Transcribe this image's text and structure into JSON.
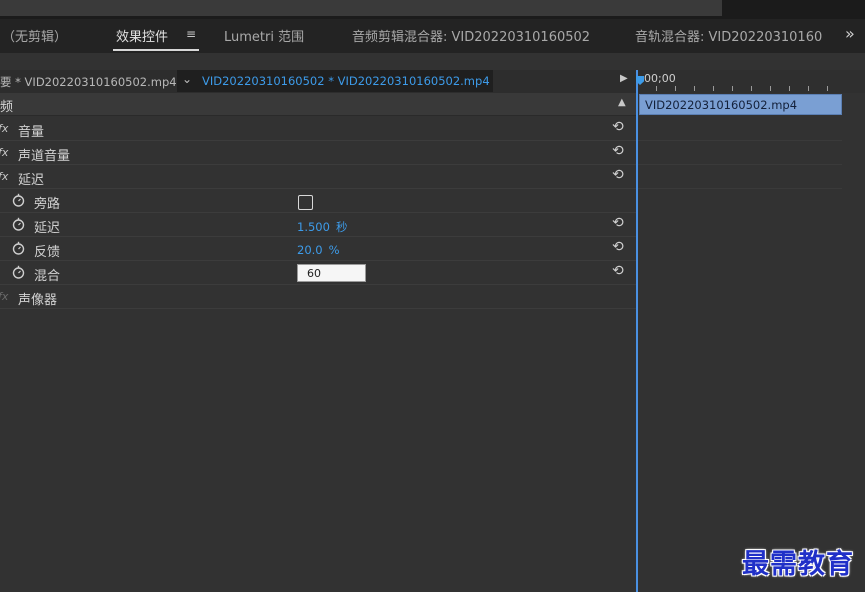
{
  "tabs": [
    {
      "label": "（无剪辑）"
    },
    {
      "label": "效果控件"
    },
    {
      "label": "Lumetri 范围"
    },
    {
      "label": "音频剪辑混合器: VID20220310160502"
    },
    {
      "label": "音轨混合器: VID20220310160"
    }
  ],
  "tab_menu_icon": "hamburger-icon",
  "overflow_icon": "double-chevron-right-icon",
  "source": {
    "master_clip": "要 * VID20220310160502.mp4",
    "sequence_clip": "VID20220310160502 * VID20220310160502.mp4"
  },
  "section": {
    "label": "频"
  },
  "effects": [
    {
      "fx": "fx",
      "label": "音量"
    },
    {
      "fx": "fx",
      "label": "声道音量"
    },
    {
      "fx": "fx",
      "label": "延迟"
    }
  ],
  "params": [
    {
      "label": "旁路"
    },
    {
      "label": "延迟",
      "value": "1.500",
      "unit": "秒"
    },
    {
      "label": "反馈",
      "value": "20.0",
      "unit": "%"
    },
    {
      "label": "混合",
      "value": "60"
    }
  ],
  "effect_last": {
    "fx": "fx",
    "label": "声像器"
  },
  "timeline": {
    "timecode": "00;00",
    "clip_name": "VID20220310160502.mp4"
  },
  "colors": {
    "accent": "#3d9be9",
    "clip": "#7a9fd3",
    "panel": "#323232"
  },
  "watermark": "最需教育"
}
